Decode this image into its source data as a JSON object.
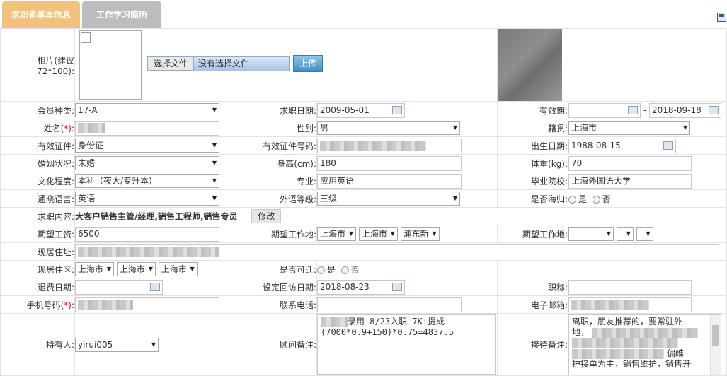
{
  "tabs": {
    "basic": "求职者基本信息",
    "history": "工作学习简历"
  },
  "photo": {
    "label": "相片(建议72*100):",
    "choose_btn": "选择文件",
    "no_file": "没有选择文件",
    "upload_btn": "上传"
  },
  "member_type": {
    "label": "会员种类:",
    "value": "17-A"
  },
  "apply_date": {
    "label": "求职日期:",
    "value": "2009-05-01"
  },
  "valid_period": {
    "label": "有效期:",
    "from": "",
    "sep": "-",
    "to": "2018-09-18"
  },
  "name": {
    "label": "姓名",
    "req": "(*)",
    "colon": ":"
  },
  "gender": {
    "label": "性别:",
    "value": "男"
  },
  "native": {
    "label": "籍贯:",
    "value": "上海市"
  },
  "id_type": {
    "label": "有效证件:",
    "value": "身份证"
  },
  "id_no": {
    "label": "有效证件号码:"
  },
  "birth": {
    "label": "出生日期:",
    "value": "1988-08-15"
  },
  "marital": {
    "label": "婚姻状况:",
    "value": "未婚"
  },
  "height": {
    "label": "身高(cm):",
    "value": "180"
  },
  "weight": {
    "label": "体重(kg):",
    "value": "70"
  },
  "education": {
    "label": "文化程度:",
    "value": "本科（夜大/专升本）"
  },
  "major": {
    "label": "专业:",
    "value": "应用英语"
  },
  "school": {
    "label": "毕业院校:",
    "value": "上海外国语大学"
  },
  "language": {
    "label": "通晓语言:",
    "value": "英语"
  },
  "lang_level": {
    "label": "外语等级:",
    "value": "三级"
  },
  "returnee": {
    "label": "是否海归:",
    "yes": "是",
    "no": "否"
  },
  "job_content": {
    "label": "求职内容:",
    "value": "大客户销售主管/经理,销售工程师,销售专员",
    "edit_btn": "修改"
  },
  "salary": {
    "label": "期望工资:",
    "value": "6500"
  },
  "work_place1": {
    "label": "期望工作地:",
    "p": "上海市",
    "c": "上海市",
    "d": "浦东新"
  },
  "work_place2": {
    "label": "期望工作地:",
    "p": "",
    "c": "",
    "d": ""
  },
  "address": {
    "label": "现居住址:"
  },
  "live_area": {
    "label": "现居住区:",
    "p": "上海市",
    "c": "上海市",
    "d": "上海市"
  },
  "relocate": {
    "label": "是否可迁:",
    "yes": "是",
    "no": "否"
  },
  "refund_date": {
    "label": "退费日期:",
    "value": ""
  },
  "visit_date": {
    "label": "设定回访日期:",
    "value": "2018-08-23"
  },
  "title": {
    "label": "职称:",
    "value": ""
  },
  "mobile": {
    "label": "手机号码",
    "req": "(*)",
    "colon": ":"
  },
  "phone": {
    "label": "联系电话:",
    "value": ""
  },
  "email": {
    "label": "电子邮箱:"
  },
  "owner": {
    "label": "持有人:",
    "value": "yirui005"
  },
  "advisor_note": {
    "label": "顾问备注:",
    "line1": "录用  8/23入职 7K+提成",
    "line2": "(7000*0.9+150)*0.75=4837.5"
  },
  "reception_note": {
    "label": "接待备注:",
    "line1": "离职，朋友推荐的，要常驻外",
    "line2": "地，",
    "line3": "偏维",
    "line4": "护接单为主，销售维护，销售开"
  }
}
